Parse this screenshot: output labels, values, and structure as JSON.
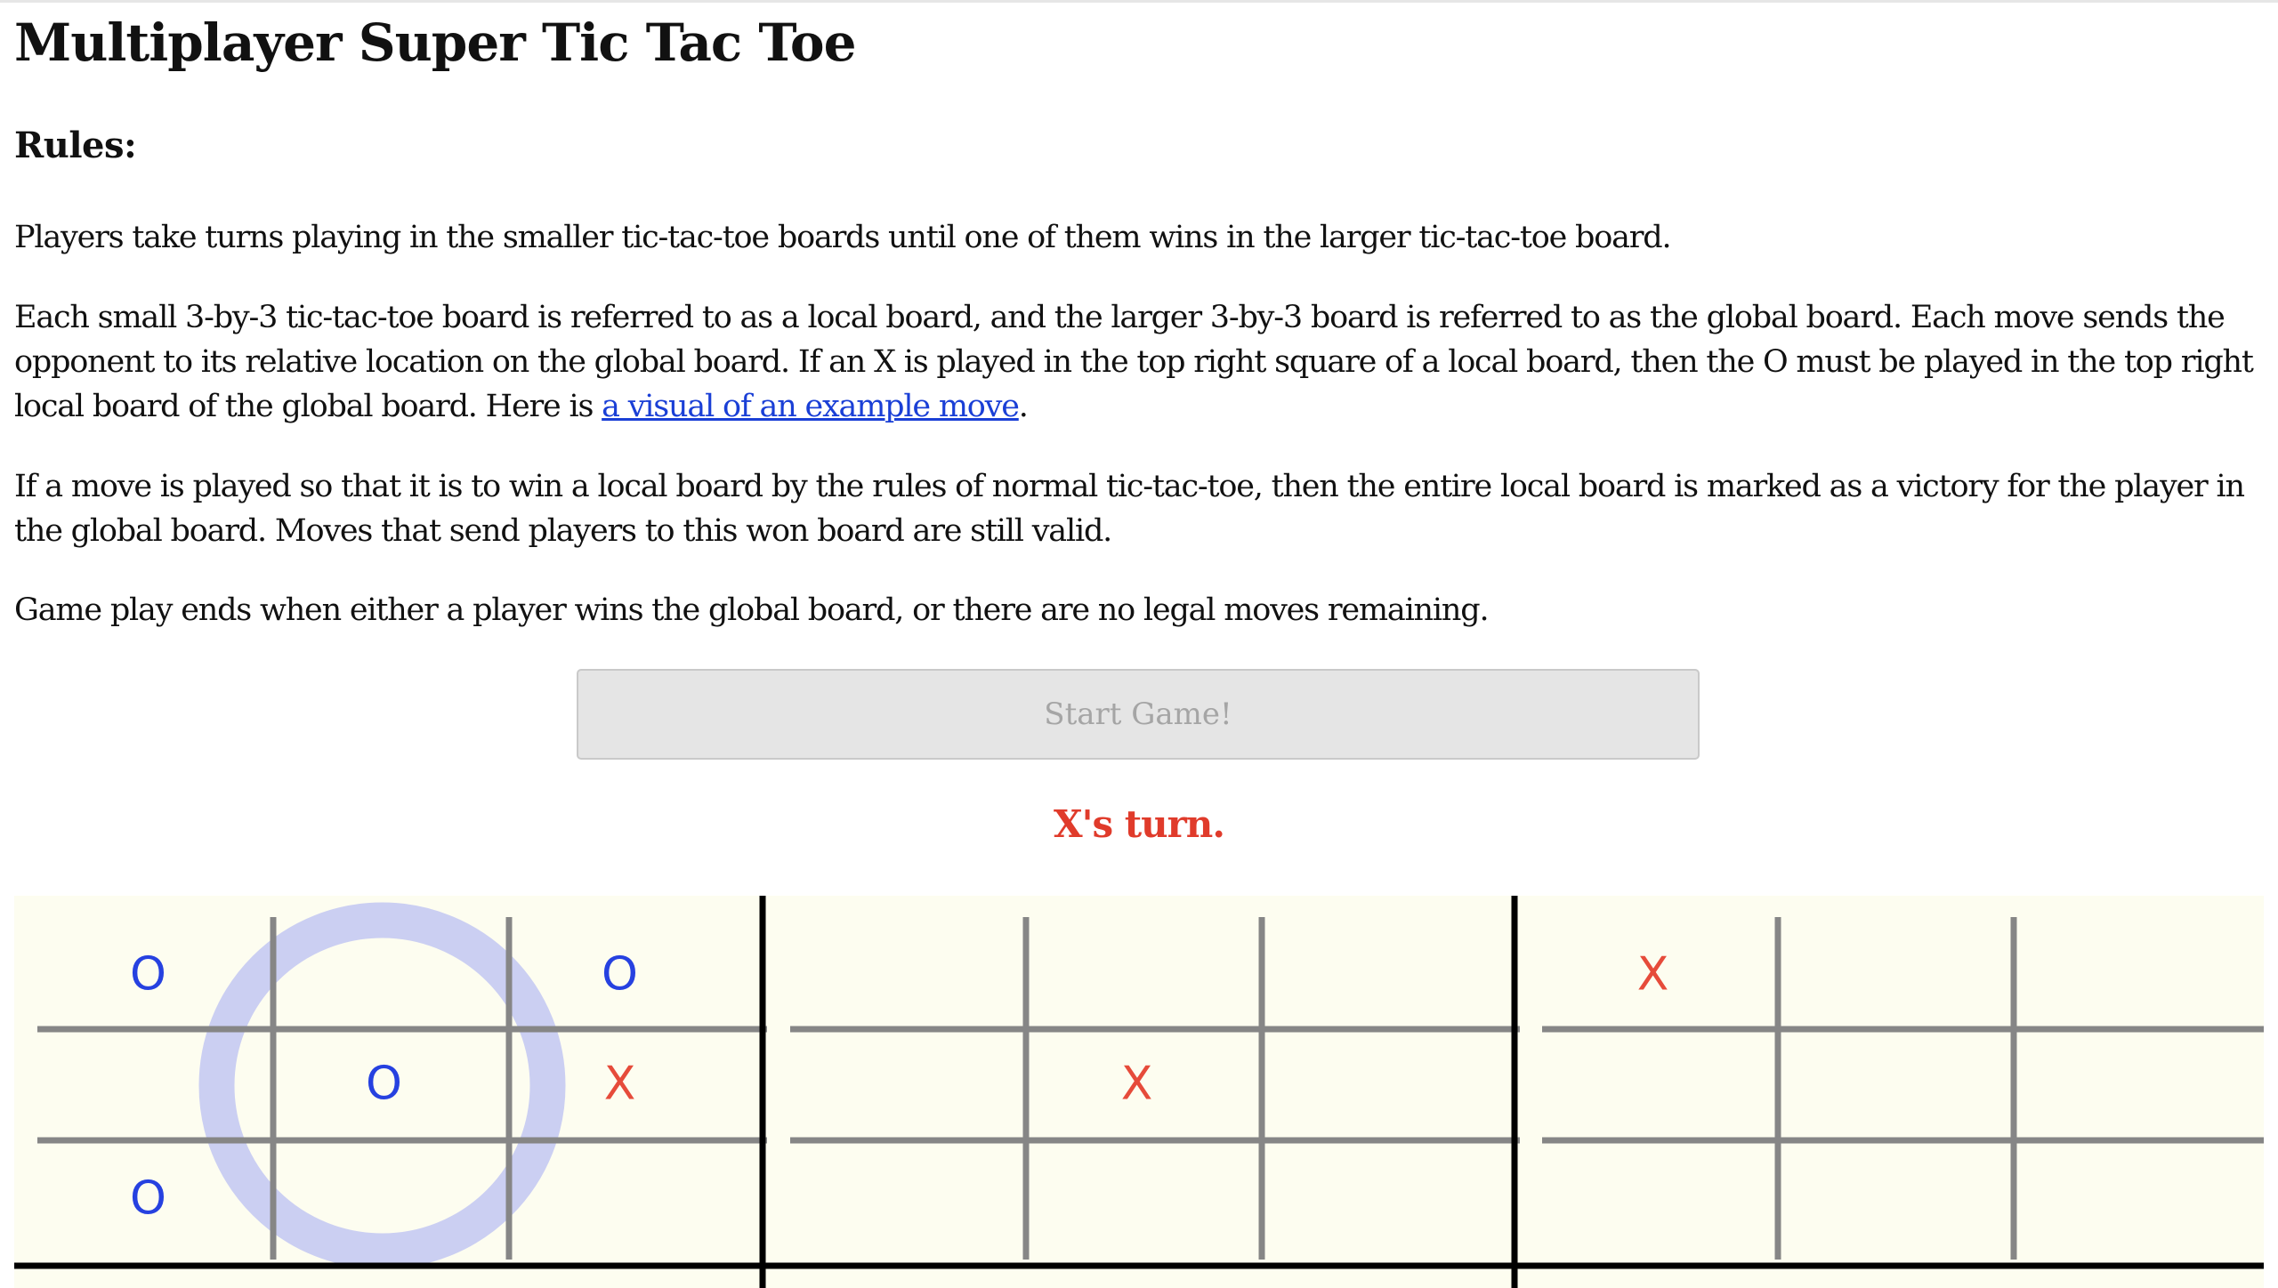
{
  "page": {
    "title": "Multiplayer Super Tic Tac Toe",
    "rules_heading": "Rules:",
    "rules": {
      "p1": "Players take turns playing in the smaller tic-tac-toe boards until one of them wins in the larger tic-tac-toe board.",
      "p2_before": "Each small 3-by-3 tic-tac-toe board is referred to as a local board, and the larger 3-by-3 board is referred to as the global board. Each move sends the opponent to its relative location on the global board. If an X is played in the top right square of a local board, then the O must be played in the top right local board of the global board. Here is ",
      "p2_link": "a visual of an example move",
      "p2_after": ".",
      "p3": "If a move is played so that it is to win a local board by the rules of normal tic-tac-toe, then the entire local board is marked as a victory for the player in the global board. Moves that send players to this won board are still valid.",
      "p4": "Game play ends when either a player wins the global board, or there are no legal moves remaining."
    },
    "start_button_label": "Start Game!",
    "start_button_disabled": true,
    "status_text": "X's turn."
  },
  "game": {
    "current_player": "X",
    "colors": {
      "x": "#e64b3a",
      "o": "#2641e0",
      "board_bg": "#fdfdf0",
      "local_grid": "#868686",
      "global_grid": "#000000",
      "won_circle": "#0c2fe8",
      "won_circle_overlay": "#cbcff2"
    },
    "won_local_boards": [
      {
        "board": 0,
        "winner": "O"
      }
    ],
    "local_boards": [
      [
        "O",
        "",
        "O",
        "",
        "O",
        "X",
        "O",
        "",
        ""
      ],
      [
        "",
        "",
        "",
        "",
        "X",
        "",
        "",
        "",
        ""
      ],
      [
        "X",
        "",
        "",
        "",
        "",
        "",
        "",
        "",
        ""
      ]
    ]
  }
}
